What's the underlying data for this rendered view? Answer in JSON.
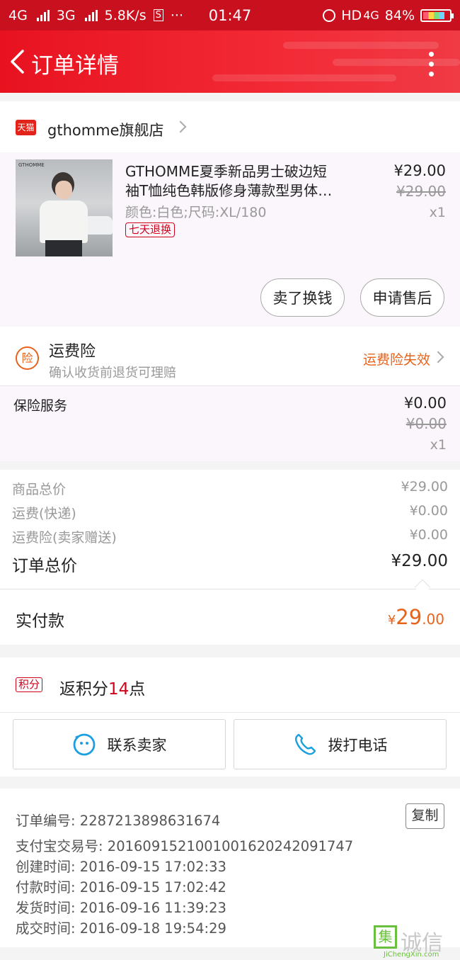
{
  "status_bar": {
    "net1": "4G",
    "net2": "3G",
    "speed": "5.8K/s",
    "s_icon": "S",
    "dots": "···",
    "time": "01:47",
    "hd": "HD",
    "net3": "4G",
    "battery": "84%",
    "battery_level": 0.84
  },
  "nav": {
    "title": "订单详情"
  },
  "shop": {
    "badge": "天猫",
    "name": "gthomme旗舰店"
  },
  "product": {
    "brand_on_image": "GTHOMME",
    "title_line1": "GTHOMME夏季新品男士破边短",
    "title_line2": "袖T恤纯色韩版修身薄款型男体…",
    "variant": "颜色:白色;尺码:XL/180",
    "return_badge": "七天退换",
    "price": "¥29.00",
    "original_price": "¥29.00",
    "quantity": "x1",
    "sell_button": "卖了换钱",
    "aftersale_button": "申请售后"
  },
  "freight_insurance": {
    "icon_char": "险",
    "title": "运费险",
    "subtitle": "确认收货前退货可理赔",
    "status": "运费险失效"
  },
  "insurance_service": {
    "label": "保险服务",
    "price": "¥0.00",
    "original_price": "¥0.00",
    "quantity": "x1"
  },
  "summary": {
    "rows": [
      {
        "label": "商品总价",
        "value": "¥29.00"
      },
      {
        "label": "运费(快递)",
        "value": "¥0.00"
      },
      {
        "label": "运费险(卖家赠送)",
        "value": "¥0.00"
      }
    ],
    "total_label": "订单总价",
    "total_value": "¥29.00"
  },
  "paid": {
    "label": "实付款",
    "currency": "¥",
    "amount_int": "29",
    "amount_dec": ".00"
  },
  "points": {
    "badge": "积分",
    "prefix": "返积分",
    "number": "14",
    "suffix": "点"
  },
  "contact": {
    "seller": "联系卖家",
    "phone": "拨打电话"
  },
  "order_info": {
    "copy_label": "复制",
    "rows": [
      {
        "label": "订单编号:",
        "value": "2287213898631674"
      },
      {
        "label": "支付宝交易号:",
        "value": "2016091521001001620242091747"
      },
      {
        "label": "创建时间:",
        "value": "2016-09-15 17:02:33"
      },
      {
        "label": "付款时间:",
        "value": "2016-09-15 17:02:42"
      },
      {
        "label": "发货时间:",
        "value": "2016-09-16 11:39:23"
      },
      {
        "label": "成交时间:",
        "value": "2016-09-18 19:54:29"
      }
    ]
  },
  "watermark": {
    "box_char": "集",
    "text": "诚信",
    "site": "JiChengXin.com"
  },
  "colors": {
    "brand_red": "#e8121f",
    "orange": "#e8631a",
    "accent_red": "#d0021b",
    "blue_icon": "#1a9fe0"
  }
}
